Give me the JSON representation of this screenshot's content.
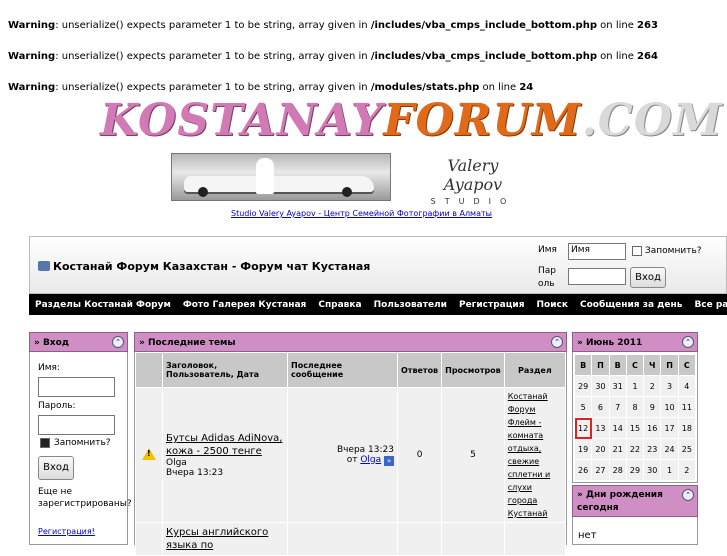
{
  "warnings": [
    {
      "prefix": "Warning",
      "message": ": unserialize() expects parameter 1 to be string, array given in ",
      "path": "/includes/vba_cmps_include_bottom.php",
      "on_line": " on line ",
      "line": "263"
    },
    {
      "prefix": "Warning",
      "message": ": unserialize() expects parameter 1 to be string, array given in ",
      "path": "/includes/vba_cmps_include_bottom.php",
      "on_line": " on line ",
      "line": "264"
    },
    {
      "prefix": "Warning",
      "message": ": unserialize() expects parameter 1 to be string, array given in ",
      "path": "/modules/stats.php",
      "on_line": " on line ",
      "line": "24"
    }
  ],
  "logo": {
    "part1": "KOSTANAY",
    "part2": "FORUM",
    "part3": ".COM"
  },
  "banner": {
    "signature": "Valery Ayapov",
    "studio": "STUDIO",
    "link": "Studio Valery Ayapov - Центр Семейной Фотографии в Алматы"
  },
  "header": {
    "title": "Костанай Форум Казахстан - Форум чат Кустаная",
    "login_name_label": "Имя",
    "login_name_value": "Имя",
    "login_pass_label": "Пароль",
    "remember_label": "Запомнить?",
    "login_button": "Вход"
  },
  "nav": [
    "Разделы Костанай Форум",
    "Фото Галерея Кустаная",
    "Справка",
    "Пользователи",
    "Регистрация",
    "Поиск",
    "Сообщения за день",
    "Все разделы прочитаны"
  ],
  "sidebar": {
    "title": "» Вход",
    "name_label": "Имя:",
    "pass_label": "Пароль:",
    "remember_label": "Запомнить?",
    "login_button": "Вход",
    "not_registered": "Еще не зарегистрированы?",
    "register_link": "Регистрация!"
  },
  "topics": {
    "title": "» Последние темы",
    "columns": [
      "Заголовок, Пользователь, Дата",
      "Последнее сообщение",
      "Ответов",
      "Просмотров",
      "Раздел"
    ],
    "rows": [
      {
        "title": "Бутсы Adidas AdiNova, кожа - 2500 тенге",
        "user": "Olga",
        "date": "Вчера 13:23",
        "last_time": "Вчера 13:23",
        "last_prefix": "от ",
        "last_user": "Olga",
        "replies": "0",
        "views": "5",
        "section": "Костанай Форум Флейм - комната отдыха, свежие сплетни и слухи города Кустанай"
      },
      {
        "title": "Курсы английского языка по",
        "user": "",
        "date": "",
        "last_time": "",
        "last_prefix": "",
        "last_user": "",
        "replies": "",
        "views": "",
        "section": ""
      }
    ]
  },
  "calendar": {
    "title": "» Июнь 2011",
    "days": [
      "В",
      "П",
      "В",
      "С",
      "Ч",
      "П",
      "С"
    ],
    "weeks": [
      [
        "29",
        "30",
        "31",
        "1",
        "2",
        "3",
        "4"
      ],
      [
        "5",
        "6",
        "7",
        "8",
        "9",
        "10",
        "11"
      ],
      [
        "12",
        "13",
        "14",
        "15",
        "16",
        "17",
        "18"
      ],
      [
        "19",
        "20",
        "21",
        "22",
        "23",
        "24",
        "25"
      ],
      [
        "26",
        "27",
        "28",
        "29",
        "30",
        "1",
        "2"
      ]
    ],
    "today": "12"
  },
  "birthdays": {
    "title": "» Дни рождения сегодня",
    "value": "нет"
  },
  "colors": {
    "panel_head": "#cf8fc4",
    "nav_bg": "#000000",
    "logo_pink": "#d27ab5",
    "logo_orange": "#e06a1a"
  }
}
